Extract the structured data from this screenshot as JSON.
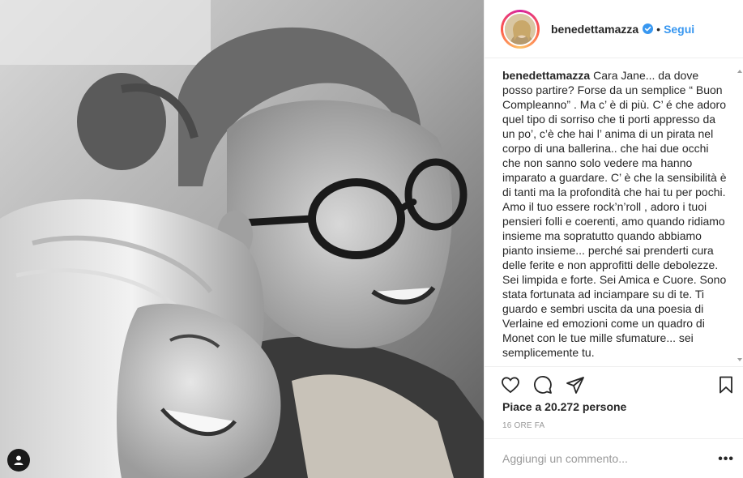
{
  "post": {
    "photo": {
      "tag_icon": "user-tag-icon"
    },
    "header": {
      "username": "benedettamazza",
      "verified_icon": "verified-badge-icon",
      "separator": "•",
      "follow_label": "Segui"
    },
    "caption": {
      "username": "benedettamazza",
      "text": "Cara Jane... da dove posso partire? Forse da un semplice “ Buon Compleanno” . Ma c’ è di più. C’ é che adoro quel tipo di sorriso che ti porti appresso da un po’, c’è che hai l’ anima di un pirata nel corpo di una ballerina.. che hai due occhi che non sanno solo vedere ma hanno imparato a guardare. C’ è che la sensibilità è di tanti ma la profondità che hai tu per pochi. Amo il tuo essere rock’n’roll , adoro i tuoi pensieri folli e coerenti, amo quando ridiamo insieme ma sopratutto quando abbiamo pianto insieme... perché sai prenderti cura delle ferite e non approfitti delle debolezze. Sei limpida e forte. Sei Amica e Cuore. Sono stata fortunata ad inciampare su di te. Ti guardo e sembri uscita da una poesia di Verlaine ed emozioni come un quadro di Monet con le tue mille sfumature... sei semplicemente tu."
    },
    "actions": {
      "like_icon": "heart-icon",
      "comment_icon": "comment-icon",
      "share_icon": "share-icon",
      "save_icon": "bookmark-icon"
    },
    "likes": {
      "prefix": "Piace a",
      "count": "20.272",
      "suffix": "persone"
    },
    "timestamp": "16 ORE FA",
    "comment_box": {
      "placeholder": "Aggiungi un commento...",
      "more_label": "•••"
    },
    "colors": {
      "link_blue": "#3897f0",
      "text": "#262626",
      "muted": "#999999",
      "divider": "#efefef"
    }
  }
}
